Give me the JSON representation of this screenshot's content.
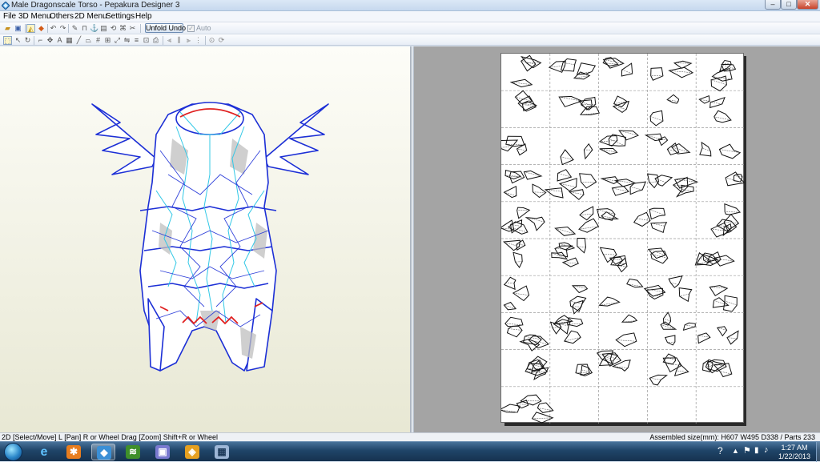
{
  "window": {
    "title": "Male Dragonscale Torso - Pepakura Designer 3",
    "controls": {
      "minimize": "–",
      "maximize": "□",
      "close": "✕"
    }
  },
  "menu": [
    "File",
    "3D Menu",
    "Others",
    "2D Menu",
    "Settings",
    "Help"
  ],
  "toolbar": {
    "unfold_undo_label": "Unfold Undo",
    "auto_label": "Auto",
    "auto_checked": true
  },
  "status": {
    "left": "2D [Select/Move] L [Pan] R or Wheel Drag [Zoom] Shift+R or Wheel",
    "right": "Assembled size(mm): H607 W495 D338 / Parts 233"
  },
  "taskbar": {
    "time": "1:27 AM",
    "date": "1/22/2013",
    "apps": [
      "internet-explorer",
      "blender",
      "pepakura-designer",
      "vegetation-app",
      "media-app",
      "paint-app",
      "calculator"
    ]
  },
  "colors": {
    "mesh_edge": "#1c2fd6",
    "fold_line": "#32c8e6",
    "cut_line": "#e02020",
    "accent": "#2a86c9"
  }
}
